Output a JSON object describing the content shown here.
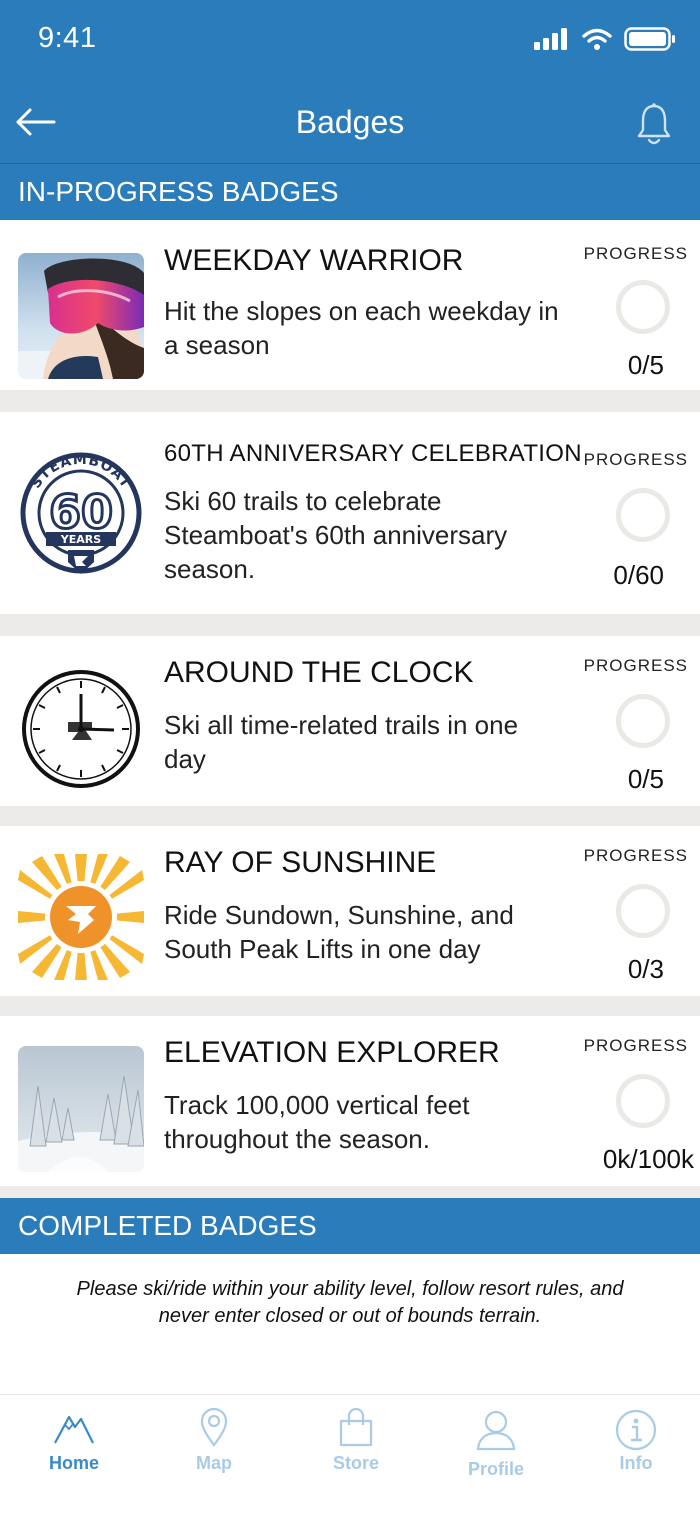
{
  "status_bar": {
    "time": "9:41"
  },
  "header": {
    "title": "Badges"
  },
  "sections": {
    "in_progress_title": "IN-PROGRESS BADGES",
    "completed_title": "COMPLETED BADGES"
  },
  "badges": [
    {
      "title": "WEEKDAY WARRIOR",
      "description": "Hit the slopes on each weekday in a season",
      "progress_label": "PROGRESS",
      "progress": "0/5",
      "image": "goggles-skier-photo"
    },
    {
      "title": "60TH ANNIVERSARY CELEBRATION",
      "description": "Ski 60 trails to celebrate Steamboat's 60th anniversary season.",
      "progress_label": "PROGRESS",
      "progress": "0/60",
      "image": "steamboat-60-years-logo",
      "logo_text": {
        "top": "STEAMBOAT",
        "number": "60",
        "bottom": "YEARS"
      }
    },
    {
      "title": "AROUND THE CLOCK",
      "description": "Ski all time-related trails in one day",
      "progress_label": "PROGRESS",
      "progress": "0/5",
      "image": "clock-logo"
    },
    {
      "title": "RAY OF SUNSHINE",
      "description": "Ride Sundown, Sunshine, and South Peak Lifts in one day",
      "progress_label": "PROGRESS",
      "progress": "0/3",
      "image": "sunshine-logo"
    },
    {
      "title": "ELEVATION EXPLORER",
      "description": "Track 100,000 vertical feet throughout the season.",
      "progress_label": "PROGRESS",
      "progress": "0k/100k",
      "image": "snowy-trees-photo"
    }
  ],
  "disclaimer": {
    "line1": "Please ski/ride within your ability level, follow resort rules, and",
    "line2": "never enter closed or out of bounds terrain."
  },
  "tabs": [
    {
      "label": "Home",
      "icon": "mountain-icon",
      "active": true
    },
    {
      "label": "Map",
      "icon": "map-pin-icon",
      "active": false
    },
    {
      "label": "Store",
      "icon": "shopping-bag-icon",
      "active": false
    },
    {
      "label": "Profile",
      "icon": "person-icon",
      "active": false
    },
    {
      "label": "Info",
      "icon": "info-icon",
      "active": false
    }
  ],
  "colors": {
    "primary_blue": "#2a7dba",
    "tab_active": "#3a8ac6",
    "tab_inactive": "#a9cbe6",
    "divider_gray": "#ecebe9",
    "sunshine_orange": "#f0922a"
  }
}
